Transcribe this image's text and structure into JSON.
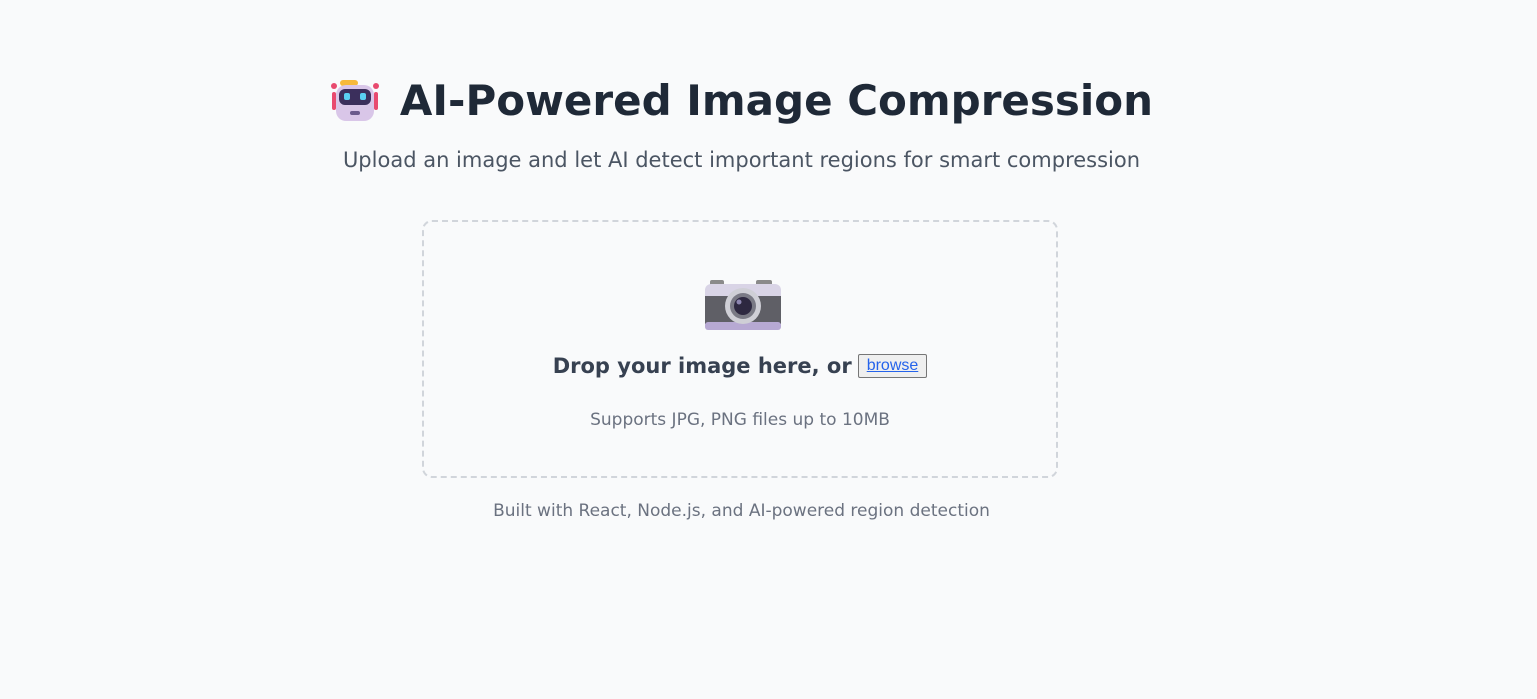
{
  "header": {
    "icon": "robot-icon",
    "title": "AI-Powered Image Compression",
    "subtitle": "Upload an image and let AI detect important regions for smart compression"
  },
  "upload": {
    "icon": "camera-icon",
    "drop_text": "Drop your image here, or",
    "browse_label": "browse",
    "supports_text": "Supports JPG, PNG files up to 10MB"
  },
  "footer": {
    "text": "Built with React, Node.js, and AI-powered region detection"
  },
  "colors": {
    "background": "#f9fafb",
    "title": "#1f2937",
    "muted": "#6b7280",
    "link": "#2563eb",
    "border": "#d1d5db"
  }
}
